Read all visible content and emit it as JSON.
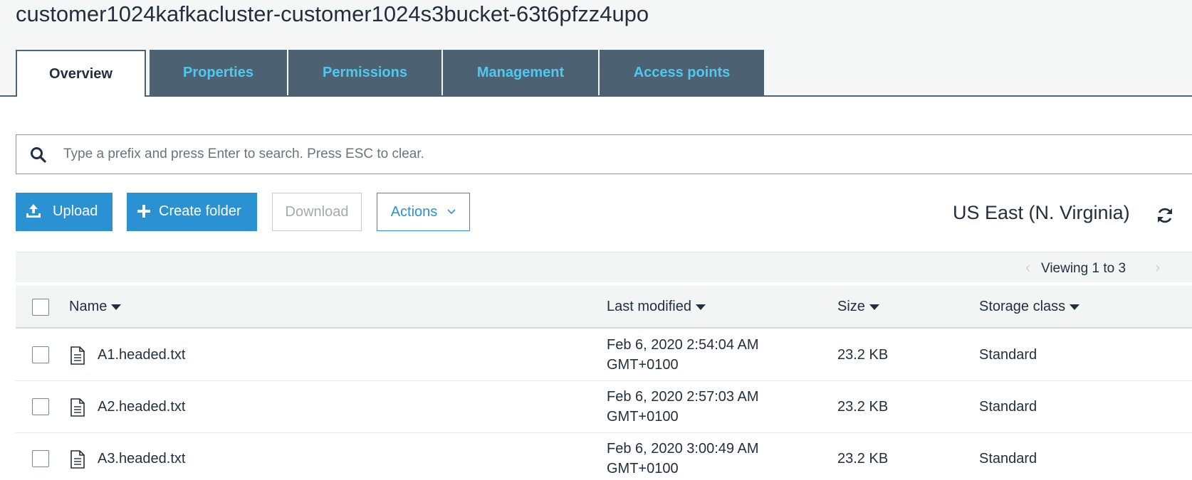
{
  "bucket": {
    "title": "customer1024kafkacluster-customer1024s3bucket-63t6pfzz4upo"
  },
  "tabs": [
    {
      "label": "Overview"
    },
    {
      "label": "Properties"
    },
    {
      "label": "Permissions"
    },
    {
      "label": "Management"
    },
    {
      "label": "Access points"
    }
  ],
  "search": {
    "placeholder": "Type a prefix and press Enter to search. Press ESC to clear.",
    "icon": "search-icon"
  },
  "toolbar": {
    "upload_label": "Upload",
    "create_folder_label": "Create folder",
    "download_label": "Download",
    "actions_label": "Actions",
    "region": "US East (N. Virginia)"
  },
  "pagination": {
    "text": "Viewing 1 to 3"
  },
  "table": {
    "columns": {
      "name": "Name",
      "last_modified": "Last modified",
      "size": "Size",
      "storage_class": "Storage class"
    },
    "rows": [
      {
        "name": "A1.headed.txt",
        "modified_date": "Feb 6, 2020 2:54:04 AM",
        "modified_tz": "GMT+0100",
        "size": "23.2 KB",
        "storage_class": "Standard"
      },
      {
        "name": "A2.headed.txt",
        "modified_date": "Feb 6, 2020 2:57:03 AM",
        "modified_tz": "GMT+0100",
        "size": "23.2 KB",
        "storage_class": "Standard"
      },
      {
        "name": "A3.headed.txt",
        "modified_date": "Feb 6, 2020 3:00:49 AM",
        "modified_tz": "GMT+0100",
        "size": "23.2 KB",
        "storage_class": "Standard"
      }
    ]
  },
  "colors": {
    "primary_button": "#2a91d2",
    "tab_background": "#4c6272",
    "tab_text": "#4fc8f0"
  }
}
